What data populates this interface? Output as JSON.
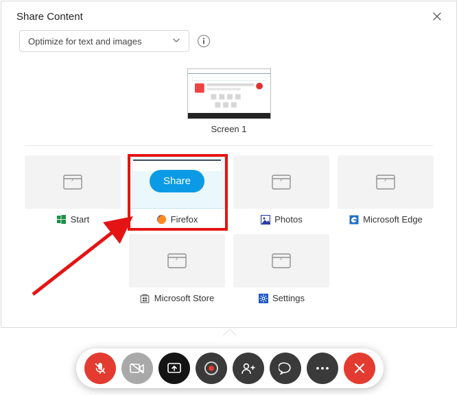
{
  "header": {
    "title": "Share Content"
  },
  "optimize": {
    "selected": "Optimize for text and images"
  },
  "screen": {
    "label": "Screen 1"
  },
  "apps": {
    "start": {
      "label": "Start"
    },
    "firefox": {
      "label": "Firefox",
      "shareLabel": "Share"
    },
    "photos": {
      "label": "Photos"
    },
    "edge": {
      "label": "Microsoft Edge"
    },
    "mstore": {
      "label": "Microsoft Store"
    },
    "settings": {
      "label": "Settings"
    }
  },
  "colors": {
    "accent": "#0a9ae6",
    "danger": "#e43b30",
    "selection": "#e51414"
  }
}
